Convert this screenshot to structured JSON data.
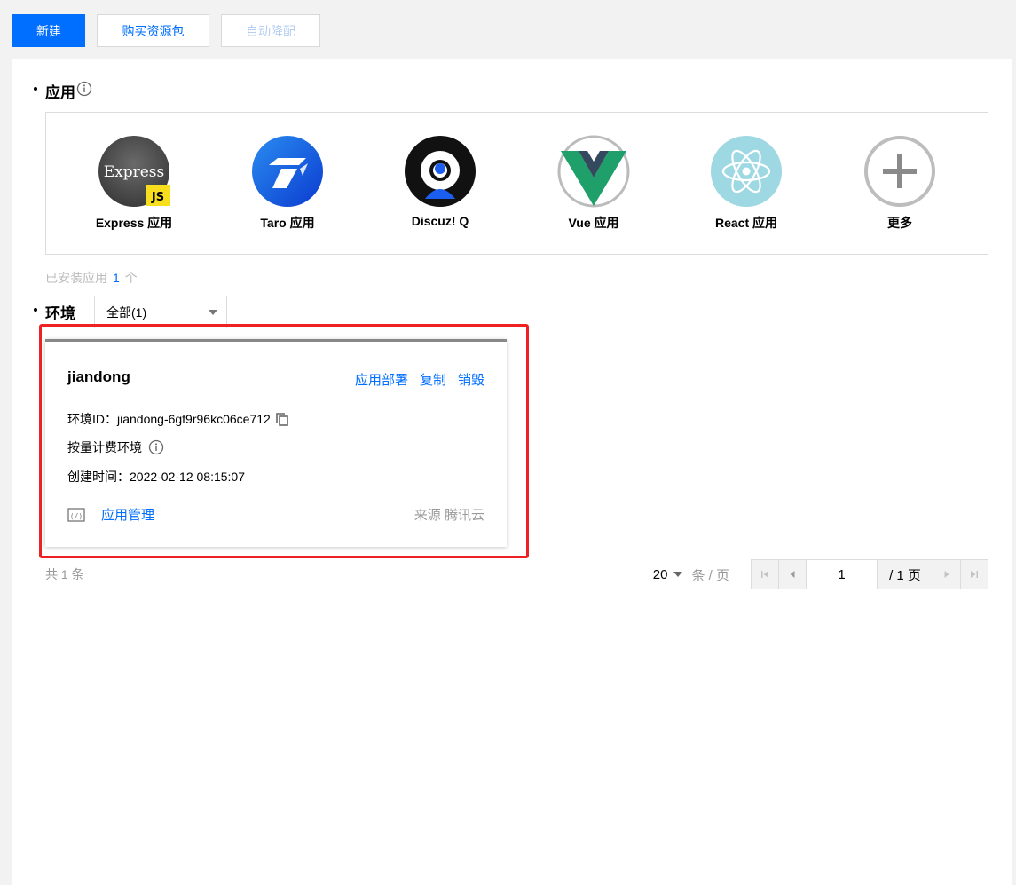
{
  "toolbar": {
    "new_label": "新建",
    "buy_label": "购买资源包",
    "auto_downgrade_label": "自动降配"
  },
  "apps_section": {
    "title": "应用",
    "apps": [
      {
        "name": "Express 应用",
        "icon": "express-logo-icon"
      },
      {
        "name": "Taro 应用",
        "icon": "taro-logo-icon"
      },
      {
        "name": "Discuz! Q",
        "icon": "discuz-logo-icon"
      },
      {
        "name": "Vue 应用",
        "icon": "vue-logo-icon"
      },
      {
        "name": "React 应用",
        "icon": "react-logo-icon"
      },
      {
        "name": "更多",
        "icon": "plus-icon"
      }
    ],
    "express_logo_text": "Express",
    "express_badge_text": "JS",
    "installed_label": "已安装应用",
    "installed_count": "1",
    "installed_unit": "个"
  },
  "env_section": {
    "title": "环境",
    "filter_value": "全部(1)"
  },
  "env_card": {
    "name": "jiandong",
    "actions": [
      "应用部署",
      "复制",
      "销毁"
    ],
    "env_id_label": "环境ID：",
    "env_id": "jiandong-6gf9r96kc06ce712",
    "billing_type": "按量计费环境",
    "created_label": "创建时间：",
    "created_time": "2022-02-12 08:15:07",
    "manage_link": "应用管理",
    "source_label": "来源",
    "source_value": "腾讯云"
  },
  "pagination": {
    "total_text": "共 1 条",
    "page_size": "20",
    "per_page_label": "条 / 页",
    "current_page": "1",
    "total_pages": "/ 1 页"
  },
  "colors": {
    "primary": "#006eff",
    "disabled_text": "#b4cdf3",
    "highlight_frame": "#ee2222"
  }
}
